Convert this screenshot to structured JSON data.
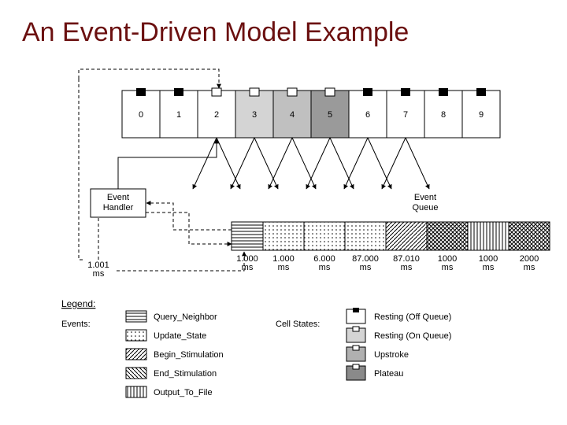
{
  "title": "An Event-Driven Model Example",
  "cells": [
    "0",
    "1",
    "2",
    "3",
    "4",
    "5",
    "6",
    "7",
    "8",
    "9"
  ],
  "event_handler": "Event\nHandler",
  "event_queue": "Event\nQueue",
  "queue_times": [
    "1.000\nms",
    "1.000\nms",
    "6.000\nms",
    "87.000\nms",
    "87.010\nms",
    "1000\nms",
    "1000\nms",
    "2000\nms"
  ],
  "t_small": "1.001\nms",
  "legend": {
    "header": "Legend:",
    "events_label": "Events:",
    "events": [
      "Query_Neighbor",
      "Update_State",
      "Begin_Stimulation",
      "End_Stimulation",
      "Output_To_File"
    ],
    "states_label": "Cell States:",
    "states": [
      "Resting (Off Queue)",
      "Resting (On Queue)",
      "Upstroke",
      "Plateau"
    ]
  }
}
